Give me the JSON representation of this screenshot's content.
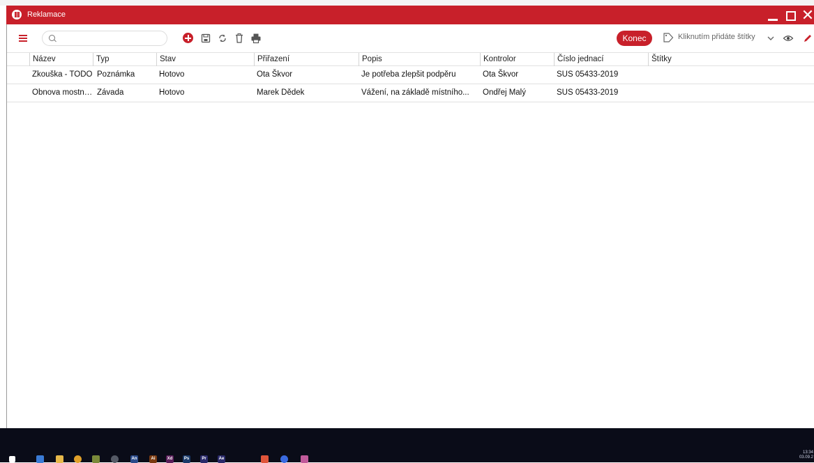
{
  "window": {
    "title": "Reklamace",
    "close_glyph": "✕"
  },
  "toolbar": {
    "search": {
      "placeholder": "",
      "value": ""
    },
    "buttons": [
      "add-icon",
      "save-icon",
      "refresh-icon",
      "delete-icon",
      "print-icon"
    ],
    "konec_label": "Konec",
    "tags_hint": "Kliknutím přidáte štítky"
  },
  "grid": {
    "columns": [
      "Název",
      "Typ",
      "Stav",
      "Přiřazení",
      "Popis",
      "Kontrolor",
      "Číslo jednací",
      "Štítky"
    ],
    "rows": [
      {
        "nazev": "Zkouška - TODO",
        "typ": "Poznámka",
        "stav": "Hotovo",
        "prirazeni": "Ota Škvor",
        "popis": "Je potřeba zlepšit podpěru",
        "kontrolor": "Ota Škvor",
        "cislo": "SUS 05433-2019",
        "stitky": ""
      },
      {
        "nazev": "Obnova mostní...",
        "typ": "Závada",
        "stav": "Hotovo",
        "prirazeni": "Marek Dědek",
        "popis": "Vážení, na základě místního...",
        "kontrolor": "Ondřej Malý",
        "cislo": "SUS 05433-2019",
        "stitky": ""
      }
    ]
  },
  "colors": {
    "accent": "#c8202a",
    "taskbar": "#0a0c18"
  },
  "taskbar": {
    "apps": [
      {
        "name": "windows-start-icon",
        "label": "",
        "color": "#ffffff"
      },
      {
        "name": "edge-icon",
        "label": "",
        "color": "#3a7bd5"
      },
      {
        "name": "file-explorer-icon",
        "label": "",
        "color": "#e6b84a"
      },
      {
        "name": "chrome-icon",
        "label": "",
        "color": "#e0a02a"
      },
      {
        "name": "app-icon",
        "label": "",
        "color": "#7a8a3a"
      },
      {
        "name": "github-icon",
        "label": "",
        "color": "#555a66"
      },
      {
        "name": "animate-icon",
        "label": "An",
        "color": "#2a4a8a"
      },
      {
        "name": "illustrator-icon",
        "label": "Ai",
        "color": "#7a3a10"
      },
      {
        "name": "xd-icon",
        "label": "Xd",
        "color": "#5a1e5a"
      },
      {
        "name": "photoshop-icon",
        "label": "Ps",
        "color": "#1a3a6a"
      },
      {
        "name": "premiere-icon",
        "label": "Pr",
        "color": "#2a2a6a"
      },
      {
        "name": "after-effects-icon",
        "label": "Ae",
        "color": "#2a2a6a"
      },
      {
        "name": "figma-icon",
        "label": "",
        "color": "#e0553a"
      },
      {
        "name": "messenger-icon",
        "label": "",
        "color": "#3a6ae0"
      },
      {
        "name": "app-window-icon",
        "label": "",
        "color": "#c05a9a"
      }
    ],
    "clock_time": "13:34",
    "clock_date": "03.09.2"
  }
}
